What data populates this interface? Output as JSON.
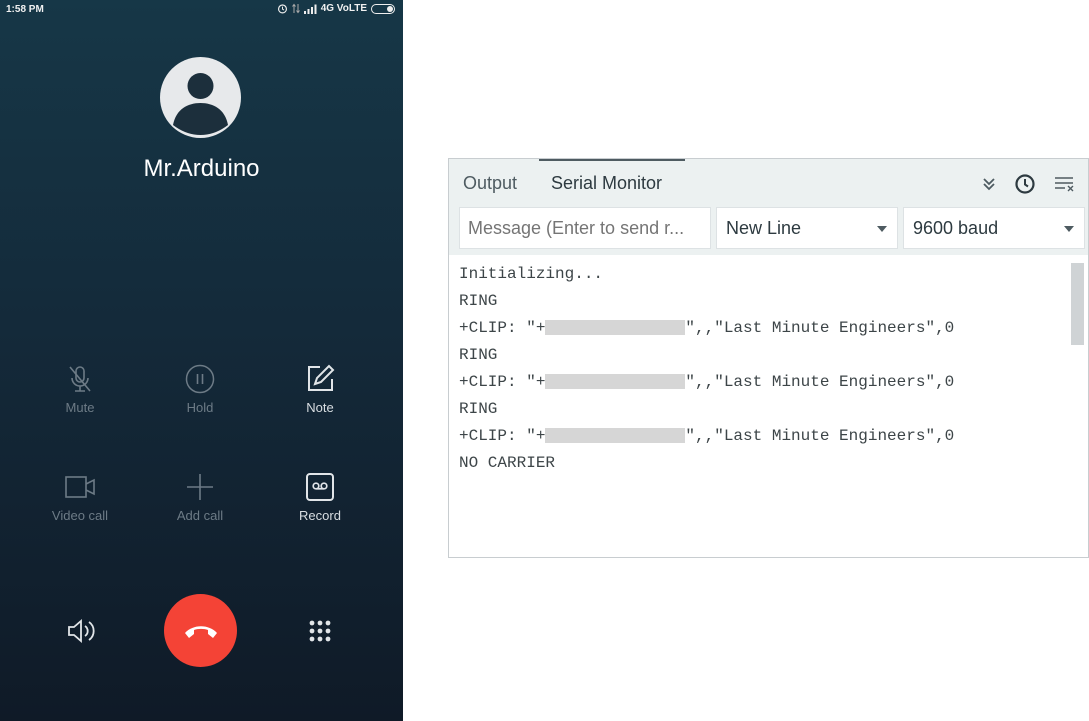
{
  "phone": {
    "status": {
      "time": "1:58 PM",
      "network": "4G VoLTE"
    },
    "caller_name": "Mr.Arduino",
    "controls": [
      {
        "label": "Mute",
        "icon": "mic-off-icon",
        "enabled": false
      },
      {
        "label": "Hold",
        "icon": "pause-icon",
        "enabled": false
      },
      {
        "label": "Note",
        "icon": "note-icon",
        "enabled": true
      },
      {
        "label": "Video call",
        "icon": "video-icon",
        "enabled": false
      },
      {
        "label": "Add call",
        "icon": "plus-icon",
        "enabled": false
      },
      {
        "label": "Record",
        "icon": "tape-icon",
        "enabled": true
      }
    ],
    "colors": {
      "end_call": "#f44336"
    }
  },
  "serial_monitor": {
    "tabs": [
      "Output",
      "Serial Monitor"
    ],
    "active_tab": "Serial Monitor",
    "message_placeholder": "Message (Enter to send r...",
    "line_ending": "New Line",
    "baud": "9600 baud",
    "lines": [
      {
        "text": "Initializing..."
      },
      {
        "text": "RING"
      },
      {
        "prefix": "+CLIP: \"+",
        "redacted": true,
        "suffix": "\",,\"Last Minute Engineers\",0"
      },
      {
        "text": "RING"
      },
      {
        "prefix": "+CLIP: \"+",
        "redacted": true,
        "suffix": "\",,\"Last Minute Engineers\",0"
      },
      {
        "text": "RING"
      },
      {
        "prefix": "+CLIP: \"+",
        "redacted": true,
        "suffix": "\",,\"Last Minute Engineers\",0"
      },
      {
        "text": "NO CARRIER"
      }
    ]
  }
}
